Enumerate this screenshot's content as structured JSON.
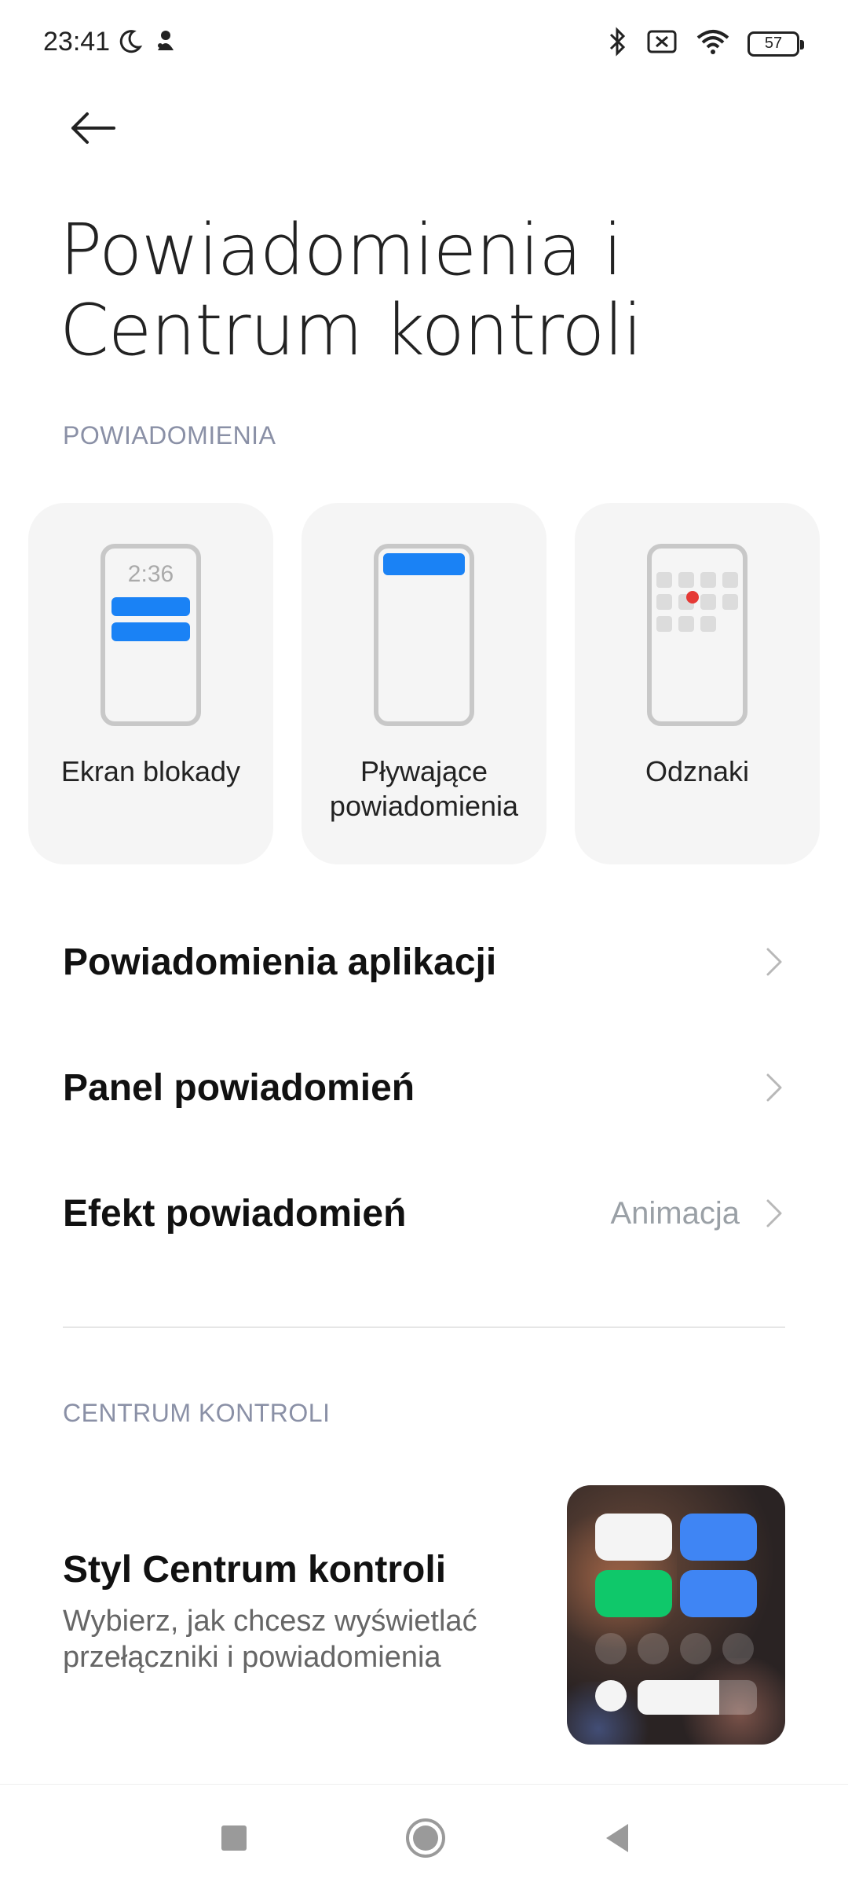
{
  "status_bar": {
    "time": "23:41",
    "left_icons": [
      "moon-icon",
      "notification-app-icon"
    ],
    "right_icons": [
      "bluetooth-icon",
      "sim-off-icon",
      "wifi-icon"
    ],
    "battery": "57"
  },
  "header": {
    "back_icon": "arrow-left-icon",
    "title_line1": "Powiadomienia i",
    "title_line2": "Centrum kontroli"
  },
  "notifications_section": {
    "header": "POWIADOMIENIA",
    "cards": [
      {
        "label": "Ekran blokady",
        "preview_time": "2:36"
      },
      {
        "label_line1": "Pływające",
        "label_line2": "powiadomienia"
      },
      {
        "label": "Odznaki"
      }
    ],
    "items": [
      {
        "label": "Powiadomienia aplikacji",
        "value": ""
      },
      {
        "label": "Panel powiadomień",
        "value": ""
      },
      {
        "label": "Efekt powiadomień",
        "value": "Animacja"
      }
    ]
  },
  "control_center_section": {
    "header": "CENTRUM KONTROLI",
    "style_item": {
      "title": "Styl Centrum kontroli",
      "description_line1": "Wybierz, jak chcesz wyświetlać",
      "description_line2": "przełączniki i powiadomienia"
    }
  },
  "nav_bar": {
    "buttons": [
      "recents-square-icon",
      "home-circle-icon",
      "back-triangle-icon"
    ]
  },
  "colors": {
    "accent_blue": "#1a82f5",
    "badge_red": "#e53935",
    "section_header": "#8a90a6",
    "card_bg": "#f5f5f5"
  }
}
